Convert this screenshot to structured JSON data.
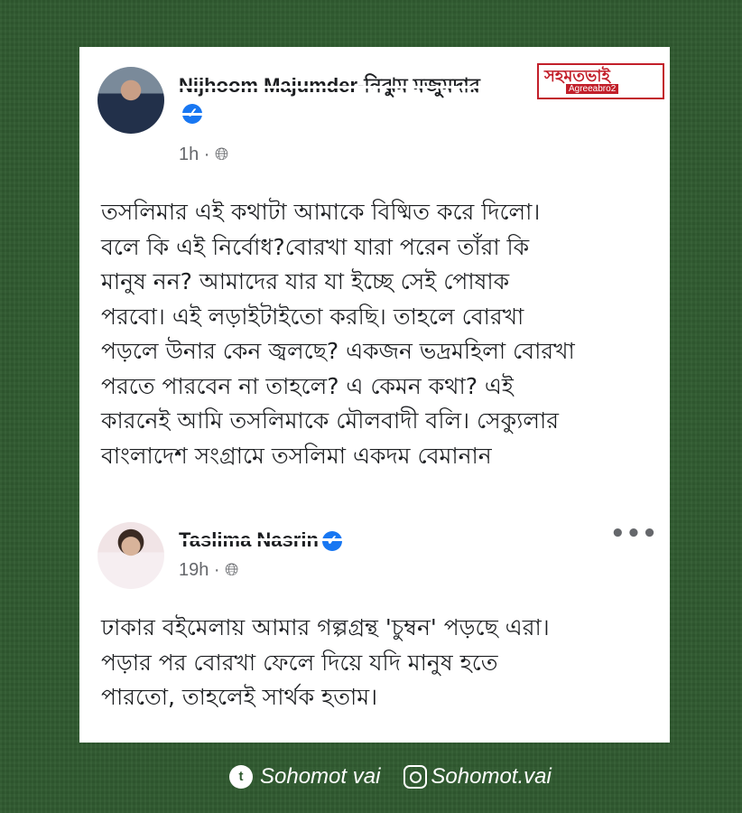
{
  "logo": {
    "main_text": "সহমতভাই",
    "sub_text": "Agreeabro2"
  },
  "post_main": {
    "author": "Nijhoom Majumder-নিঝুম মজুমদার",
    "time": "1h",
    "privacy_icon": "globe-icon",
    "lines": [
      "তসলিমার এই কথাটা আমাকে বিষ্মিত করে দিলো।",
      "বলে কি এই নির্বোধ?বোরখা যারা পরেন তাঁরা কি",
      "মানুষ নন? আমাদের যার যা ইচ্ছে সেই পোষাক",
      "পরবো। এই লড়াইটাইতো করছি। তাহলে বোরখা",
      "পড়লে উনার কেন জ্বলছে? একজন ভদ্রমহিলা বোরখা",
      "পরতে পারবেন না তাহলে? এ কেমন কথা? এই",
      "কারনেই আমি তসলিমাকে মৌলবাদী বলি। সেক্যুলার",
      "বাংলাদেশ সংগ্রামে তসলিমা একদম বেমানান"
    ]
  },
  "post_quoted": {
    "author": "Taslima Nasrin",
    "time": "19h",
    "privacy_icon": "globe-icon",
    "more_label": "•••",
    "lines": [
      "ঢাকার বইমেলায় আমার গল্পগ্রন্থ 'চুম্বন' পড়ছে এরা।",
      "পড়ার পর বোরখা ফেলে দিয়ে  যদি মানুষ হতে",
      "পারতো, তাহলেই সার্থক হতাম।"
    ]
  },
  "footer": {
    "twitter_handle": "Sohomot vai",
    "instagram_handle": "Sohomot.vai"
  },
  "colors": {
    "background": "#2f5a2f",
    "verified": "#1877f2",
    "logo_red": "#c21f2a"
  }
}
